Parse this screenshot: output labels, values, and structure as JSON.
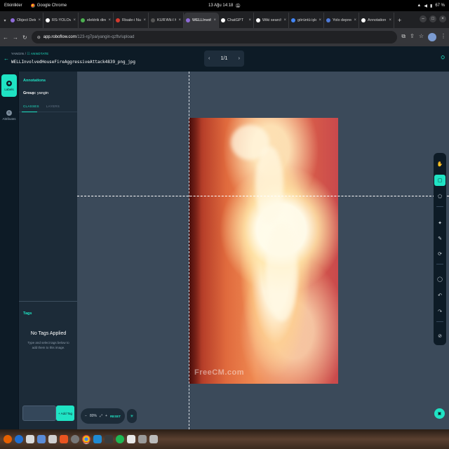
{
  "system_bar": {
    "activities": "Etkinlikler",
    "app_name": "Google Chrome",
    "clock": "13 Ağu  14:18",
    "battery": "67 %"
  },
  "browser": {
    "tabs": [
      {
        "label": "Object Dete",
        "color": "#8e6bd8",
        "active": false
      },
      {
        "label": "RS-YOLOv",
        "color": "#ffffff",
        "active": false
      },
      {
        "label": "elektrik dire",
        "color": "#4caf50",
        "active": false
      },
      {
        "label": "Risale-i Nur",
        "color": "#d33b2f",
        "active": false
      },
      {
        "label": "KUR'AN-I K",
        "color": "#555555",
        "active": false
      },
      {
        "label": "WELLInvolv",
        "color": "#8e6bd8",
        "active": true
      },
      {
        "label": "ChatGPT",
        "color": "#ffffff",
        "active": false
      },
      {
        "label": "Wiki search",
        "color": "#ffffff",
        "active": false
      },
      {
        "label": "görüntü işle",
        "color": "#4285f4",
        "active": false
      },
      {
        "label": "Yolo deprec",
        "color": "#4f7bd9",
        "active": false
      },
      {
        "label": "Annotation",
        "color": "#ffffff",
        "active": false
      }
    ],
    "url_host": "app.roboflow.com",
    "url_path": "/123-rg7pa/yangin-qzftv/upload"
  },
  "header": {
    "workspace": "YANGIN",
    "section": "ANNOTATE",
    "filename": "WELLInvolvedHouseFireAggressiveAttack4839_png_jpg",
    "page_counter": "1/1"
  },
  "rail": {
    "labels": "Labels",
    "attributes": "Attributes"
  },
  "panel": {
    "title": "Annotations",
    "group_label": "Group:",
    "group_value": "yangin",
    "tab_classes": "CLASSES",
    "tab_layers": "LAYERS",
    "tags_title": "Tags",
    "tags_empty": "No Tags Applied",
    "tags_help": "Type and select tags below to add them to this image.",
    "add_tag": "+ Add Tag"
  },
  "canvas": {
    "watermark": "FreeCM.com",
    "zoom": "80%",
    "reset": "RESET"
  },
  "toolbar_icons": [
    "hand-icon",
    "bounding-box-icon",
    "polygon-icon",
    "smart-polygon-icon",
    "label-assist-icon",
    "repeat-icon",
    "comment-icon",
    "undo-icon",
    "redo-icon",
    "null-icon"
  ]
}
